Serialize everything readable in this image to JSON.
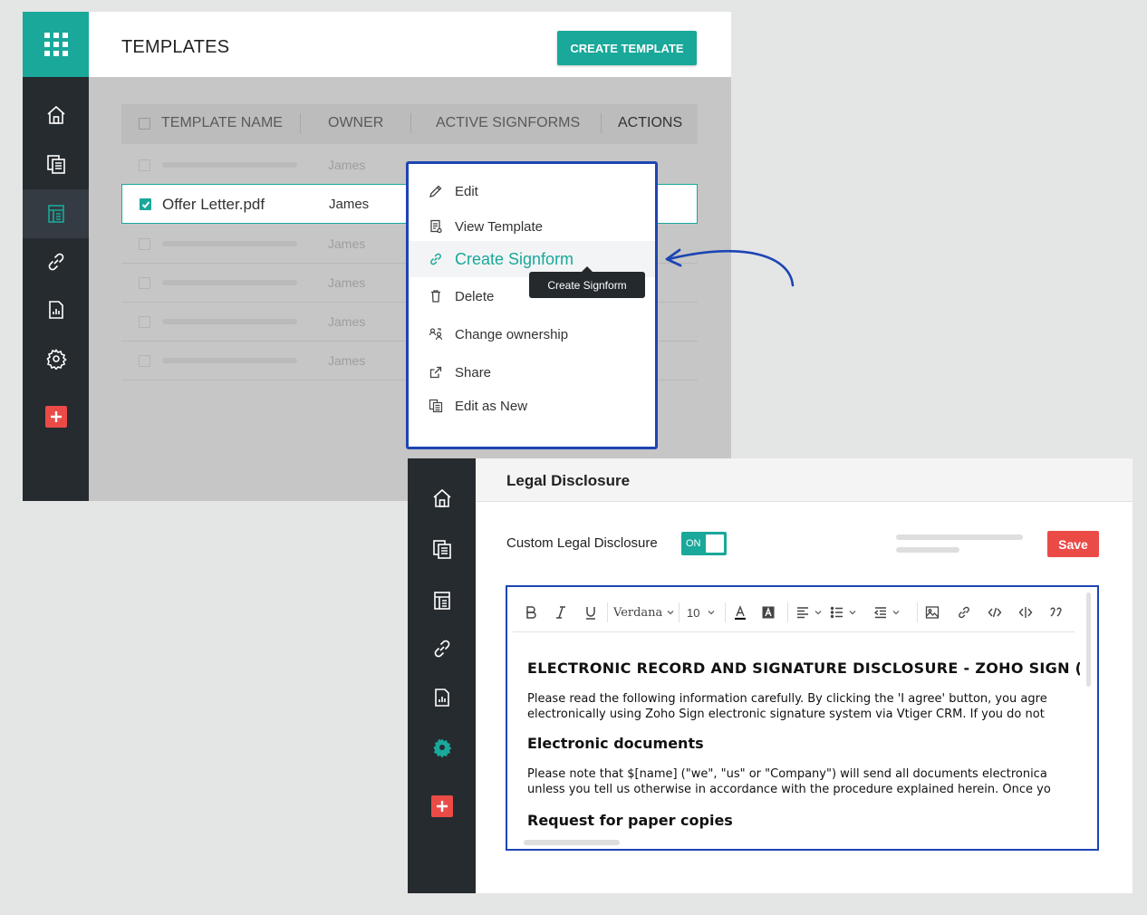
{
  "templates_panel": {
    "title": "TEMPLATES",
    "create_button": "CREATE TEMPLATE",
    "columns": [
      "TEMPLATE NAME",
      "OWNER",
      "ACTIVE SIGNFORMS",
      "ACTIONS"
    ],
    "rows": [
      {
        "name": "",
        "owner": "James",
        "selected": false
      },
      {
        "name": "Offer Letter.pdf",
        "owner": "James",
        "selected": true
      },
      {
        "name": "",
        "owner": "James",
        "selected": false
      },
      {
        "name": "",
        "owner": "James",
        "selected": false
      },
      {
        "name": "",
        "owner": "James",
        "selected": false
      },
      {
        "name": "",
        "owner": "James",
        "selected": false
      }
    ],
    "sidebar": [
      "apps-grid-icon",
      "home-icon",
      "documents-icon",
      "templates-icon",
      "link-icon",
      "reports-icon",
      "settings-icon",
      "add-icon"
    ]
  },
  "context_menu": {
    "items": [
      {
        "label": "Edit",
        "icon": "pencil-icon"
      },
      {
        "label": "View Template",
        "icon": "view-document-icon"
      },
      {
        "label": "Create Signform",
        "icon": "link-icon",
        "highlighted": true
      },
      {
        "label": "Delete",
        "icon": "trash-icon"
      },
      {
        "label": "Change ownership",
        "icon": "change-owner-icon"
      },
      {
        "label": "Share",
        "icon": "share-icon"
      },
      {
        "label": "Edit as New",
        "icon": "copy-document-icon"
      }
    ],
    "tooltip": "Create Signform"
  },
  "legal_panel": {
    "title": "Legal Disclosure",
    "toggle_label": "Custom Legal Disclosure",
    "toggle_state": "ON",
    "save_button": "Save",
    "toolbar": {
      "font": "Verdana",
      "size": "10"
    },
    "document": {
      "heading": "ELECTRONIC RECORD AND SIGNATURE DISCLOSURE - ZOHO SIGN (",
      "para1_line1": "Please read the following information carefully. By clicking the 'I agree' button, you agre",
      "para1_line2": "electronically using Zoho Sign electronic signature system via Vtiger CRM. If you do not",
      "subheading": "Electronic documents",
      "para2_line1": "Please note that $[name] (\"we\", \"us\" or \"Company\") will send all documents electronica",
      "para2_line2": "unless you tell us otherwise in accordance with the procedure explained herein. Once yo",
      "subheading2": "Request for paper copies"
    }
  },
  "colors": {
    "accent": "#19a89a",
    "sidebar": "#262b30",
    "danger": "#ea4b47",
    "highlight_border": "#1d45b3"
  }
}
